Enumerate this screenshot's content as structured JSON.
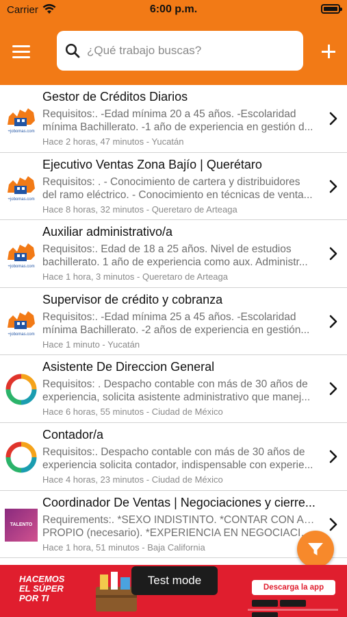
{
  "status_bar": {
    "carrier": "Carrier",
    "time": "6:00 p.m."
  },
  "header": {
    "search": {
      "placeholder": "¿Qué trabajo buscas?",
      "value": ""
    }
  },
  "colors": {
    "brand": "#F27A16",
    "fab": "#F7892B",
    "ad": "#E01E2E"
  },
  "jobs": [
    {
      "title": "Gestor de Créditos Diarios",
      "desc1": "Requisitos:. -Edad mínima 20 a 45 años. -Escolaridad",
      "desc2": "mínima Bachillerato. -1 año de experiencia en gestión d...",
      "meta": "Hace 2 horas, 47 minutos - Yucatán",
      "logo": "jobomas-logo"
    },
    {
      "title": "Ejecutivo Ventas Zona Bajío | Querétaro",
      "desc1": "Requisitos: . - Conocimiento de cartera y distribuidores",
      "desc2": "del ramo eléctrico. - Conocimiento en técnicas de venta...",
      "meta": "Hace 8 horas, 32 minutos - Queretaro de Arteaga",
      "logo": "jobomas-logo"
    },
    {
      "title": "Auxiliar administrativo/a",
      "desc1": "Requisitos:. Edad de 18 a 25 años. Nivel de estudios",
      "desc2": "bachillerato. 1 año de experiencia como aux. Administr...",
      "meta": "Hace 1 hora, 3 minutos - Queretaro de Arteaga",
      "logo": "jobomas-logo"
    },
    {
      "title": "Supervisor de crédito y cobranza",
      "desc1": "Requisitos:. -Edad mínima 25 a 45 años. -Escolaridad",
      "desc2": "mínima Bachillerato. -2 años de experiencia en gestión...",
      "meta": "Hace 1 minuto - Yucatán",
      "logo": "jobomas-logo"
    },
    {
      "title": "Asistente De Direccion General",
      "desc1": "Requisitos: . Despacho contable con más de 30 años de",
      "desc2": "experiencia, solicita asistente administrativo que manej...",
      "meta": "Hace 6 horas, 55 minutos - Ciudad de México",
      "logo": "ring-logo"
    },
    {
      "title": "Contador/a",
      "desc1": "Requisitos:. Despacho contable con más de 30 años de",
      "desc2": "experiencia solicita contador, indispensable con experie...",
      "meta": "Hace 4 horas, 23 minutos - Ciudad de México",
      "logo": "ring-logo"
    },
    {
      "title": "Coordinador De Ventas | Negociaciones y cierre...",
      "desc1": "Requirements:. *SEXO INDISTINTO. *CONTAR CON AUTO",
      "desc2": "PROPIO (necesario). *EXPERIENCIA EN NEGOCIACION...",
      "meta": "Hace 1 hora, 51 minutos - Baja California",
      "logo": "talento-logo"
    }
  ],
  "ad": {
    "headline": [
      "HACEMOS",
      "EL SÚPER",
      "POR TI"
    ],
    "cta": "Descarga la app",
    "test_mode": "Test mode"
  },
  "logo_text": {
    "jobomas": "+jobomas.com",
    "talento": "TALENTO"
  }
}
